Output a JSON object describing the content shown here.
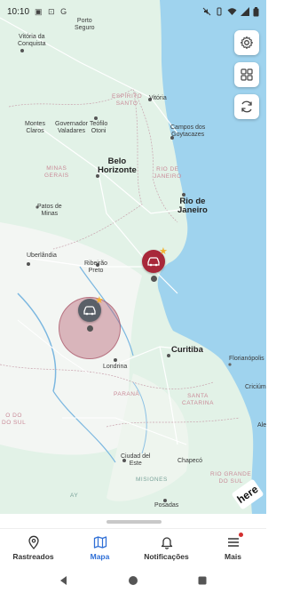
{
  "status_bar": {
    "time": "10:10",
    "left_icons": "▣ ⊡ G"
  },
  "map": {
    "cities": {
      "vitoria_conquista": "Vitória da\nConquista",
      "porto_seguro": "Porto\nSeguro",
      "teofilo": "Teófilo\nOtoni",
      "vitoria": "Vitória",
      "montes_claros": "Montes\nClaros",
      "governador": "Governador\nValadares",
      "campos": "Campos dos\nGoytacazes",
      "belo_horizonte": "Belo\nHorizonte",
      "rio": "Rio de\nJaneiro",
      "patos": "Patos de\nMinas",
      "uberlandia": "Uberlândia",
      "ribeirao": "Ribeirão\nPreto",
      "curitiba": "Curitiba",
      "florianopolis": "Florianópolis",
      "criciuma": "Criciúm",
      "londrina": "Londrina",
      "chapeco": "Chapecó",
      "ciudad_este": "Ciudad del\nEste",
      "posadas": "Posadas",
      "ale": "Ale"
    },
    "states": {
      "espirito_santo": "ESPÍRITO\nSANTO",
      "minas_gerais": "MINAS\nGERAIS",
      "rio_de_janeiro": "RIO DE\nJANEIRO",
      "parana": "PARANÁ",
      "santa_catarina": "SANTA\nCATARINA",
      "rio_grande_sul": "RIO GRANDE\nDO SUL",
      "do_sul_left": "O DO\nDO SUL",
      "misiones": "MISIONES",
      "ay": "AY"
    },
    "attribution": "here"
  },
  "bottom_nav": {
    "items": [
      {
        "label": "Rastreados",
        "icon": "location-pin-icon"
      },
      {
        "label": "Mapa",
        "icon": "map-icon"
      },
      {
        "label": "Notificações",
        "icon": "bell-icon"
      },
      {
        "label": "Mais",
        "icon": "menu-icon"
      }
    ],
    "active_index": 1
  },
  "colors": {
    "accent": "#2f6fd6",
    "ocean": "#9fd3ee",
    "land": "#dff0e6",
    "marker_red": "#a8283a",
    "marker_gray": "#5a6068",
    "badge": "#d32f2f"
  }
}
